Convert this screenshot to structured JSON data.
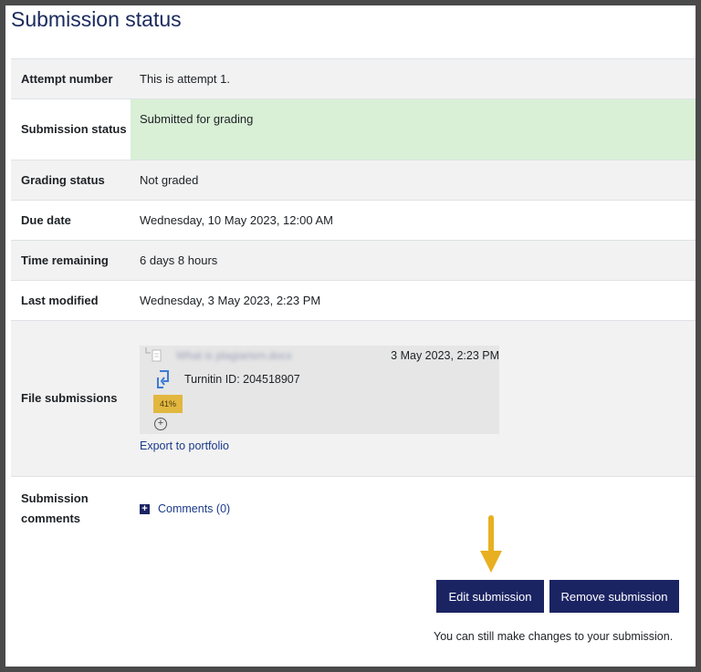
{
  "page": {
    "title": "Submission status"
  },
  "rows": {
    "attempt": {
      "label": "Attempt number",
      "value": "This is attempt 1."
    },
    "submission_status": {
      "label": "Submission status",
      "value": "Submitted for grading"
    },
    "grading": {
      "label": "Grading status",
      "value": "Not graded"
    },
    "due": {
      "label": "Due date",
      "value": "Wednesday, 10 May 2023, 12:00 AM"
    },
    "remaining": {
      "label": "Time remaining",
      "value": "6 days 8 hours"
    },
    "modified": {
      "label": "Last modified",
      "value": "Wednesday, 3 May 2023, 2:23 PM"
    },
    "files": {
      "label": "File submissions",
      "file_name": "What is plagiarism.docx",
      "file_date": "3 May 2023, 2:23 PM",
      "turnitin_id": "Turnitin ID: 204518907",
      "similarity": "41%",
      "export_label": "Export to portfolio"
    },
    "comments": {
      "label": "Submission comments",
      "link": "Comments (0)"
    }
  },
  "actions": {
    "edit_label": "Edit submission",
    "remove_label": "Remove submission",
    "note": "You can still make changes to your submission."
  },
  "colors": {
    "accent": "#1b2463",
    "submitted_bg": "#d9efd6",
    "similarity_badge": "#e2b73f",
    "annotation_arrow": "#e8b020"
  },
  "icons": [
    "file-icon",
    "turnitin-icon",
    "plus-circle-icon",
    "plus-square-icon",
    "down-arrow-annotation"
  ]
}
